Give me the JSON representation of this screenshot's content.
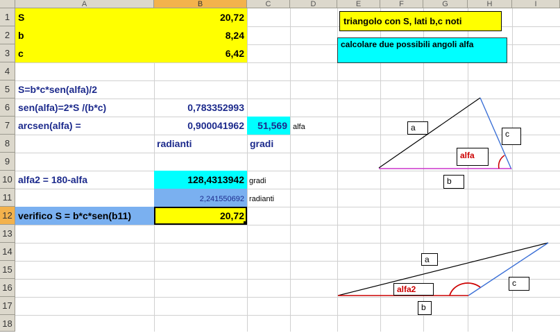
{
  "columns": [
    "A",
    "B",
    "C",
    "D",
    "E",
    "F",
    "G",
    "H",
    "I"
  ],
  "rows": [
    "1",
    "2",
    "3",
    "4",
    "5",
    "6",
    "7",
    "8",
    "9",
    "10",
    "11",
    "12",
    "13",
    "14",
    "15",
    "16",
    "17",
    "18"
  ],
  "cells": {
    "a1": "S",
    "b1": "20,72",
    "a2": "b",
    "b2": "8,24",
    "a3": "c",
    "b3": "6,42",
    "a5": "S=b*c*sen(alfa)/2",
    "a6": "sen(alfa)=2*S /(b*c)",
    "b6": "0,783352993",
    "a7": "arcsen(alfa) =",
    "b7": "0,900041962",
    "c7": "51,569",
    "d7": "alfa",
    "b8": "radianti",
    "c8": "gradi",
    "a10": "alfa2 = 180-alfa",
    "b10": "128,4313942",
    "c10": "gradi",
    "b11": "2,241550692",
    "c11": "radianti",
    "a12": "verifico S = b*c*sen(b11)",
    "b12": "20,72"
  },
  "textboxes": {
    "title": "triangolo con S, lati b,c noti",
    "task": "calcolare due possibili angoli alfa"
  },
  "triangle1": {
    "label_a": "a",
    "label_b": "b",
    "label_c": "c",
    "label_angle": "alfa"
  },
  "triangle2": {
    "label_a": "a",
    "label_b": "b",
    "label_c": "c",
    "label_angle": "alfa2"
  },
  "colors": {
    "yellow": "#ffff00",
    "cyan": "#00ffff",
    "blue_fill": "#7ab0f0",
    "text_blue": "#1c2a8c",
    "header": "#dcd8cc",
    "header_selected": "#f3b24c"
  }
}
